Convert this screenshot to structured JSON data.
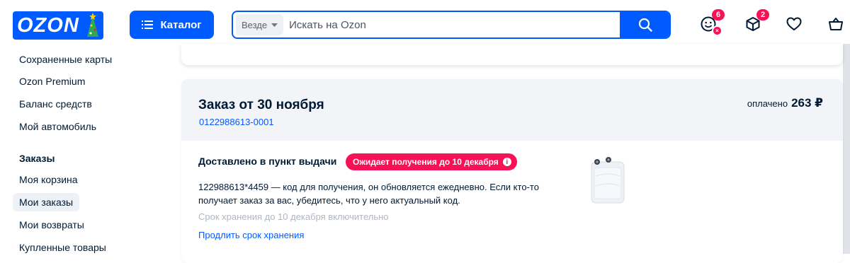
{
  "header": {
    "logo_text": "OZON",
    "catalog_label": "Каталог",
    "search": {
      "scope": "Везде",
      "placeholder": "Искать на Ozon"
    },
    "icons": [
      {
        "name": "profile-icon",
        "badge": "6"
      },
      {
        "name": "orders-icon",
        "badge": "2"
      },
      {
        "name": "favorites-icon",
        "badge": ""
      },
      {
        "name": "cart-icon",
        "badge": ""
      }
    ]
  },
  "sidebar": {
    "items": [
      {
        "label": "Сохраненные карты"
      },
      {
        "label": "Ozon Premium"
      },
      {
        "label": "Баланс средств"
      },
      {
        "label": "Мой автомобиль"
      }
    ],
    "section_title": "Заказы",
    "order_items": [
      {
        "label": "Моя корзина",
        "active": false
      },
      {
        "label": "Мои заказы",
        "active": true
      },
      {
        "label": "Мои возвраты",
        "active": false
      },
      {
        "label": "Купленные товары",
        "active": false
      }
    ]
  },
  "order": {
    "title": "Заказ от 30 ноября",
    "number": "0122988613-0001",
    "paid_label": "оплачено",
    "paid_amount": "263 ₽",
    "status": "Доставлено в пункт выдачи",
    "pill": "Ожидает получения до 10 декабря",
    "pickup_text": "122988613*4459 — код для получения, он обновляется ежедневно. Если кто-то получает заказ за вас, убедитесь, что у него актуальный код.",
    "storage_text": "Срок хранения до 10 декабря включительно",
    "extend_link": "Продлить срок хранения"
  },
  "colors": {
    "brand": "#005bff",
    "accent": "#f91155",
    "panel": "#f2f4f7"
  }
}
